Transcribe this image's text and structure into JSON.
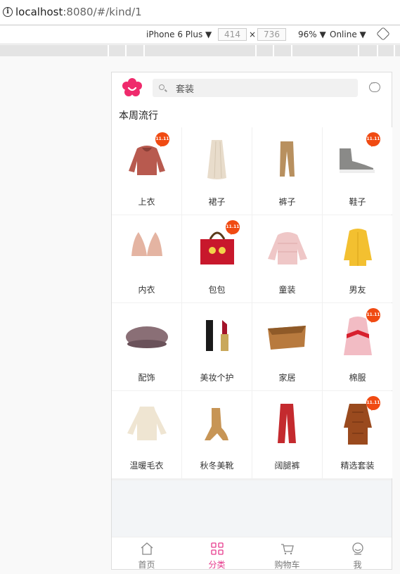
{
  "browser": {
    "url_host": "localhost",
    "url_rest": ":8080/#/kind/1"
  },
  "devtools": {
    "device": "iPhone 6 Plus ▼",
    "width": "414",
    "times": "×",
    "height": "736",
    "zoom": "96% ▼",
    "network": "Online ▼"
  },
  "header": {
    "search_placeholder": "套装"
  },
  "section_title": "本周流行",
  "badge_text": "11.11",
  "categories": [
    {
      "label": "上衣",
      "badge": true
    },
    {
      "label": "裙子",
      "badge": false
    },
    {
      "label": "裤子",
      "badge": false
    },
    {
      "label": "鞋子",
      "badge": true
    },
    {
      "label": "内衣",
      "badge": false
    },
    {
      "label": "包包",
      "badge": true
    },
    {
      "label": "童装",
      "badge": false
    },
    {
      "label": "男友",
      "badge": false
    },
    {
      "label": "配饰",
      "badge": false
    },
    {
      "label": "美妆个护",
      "badge": false
    },
    {
      "label": "家居",
      "badge": false
    },
    {
      "label": "棉服",
      "badge": true
    },
    {
      "label": "温暖毛衣",
      "badge": false
    },
    {
      "label": "秋冬美靴",
      "badge": false
    },
    {
      "label": "阔腿裤",
      "badge": false
    },
    {
      "label": "精选套装",
      "badge": true
    }
  ],
  "tabs": [
    {
      "label": "首页",
      "icon": "home-icon",
      "active": false
    },
    {
      "label": "分类",
      "icon": "category-icon",
      "active": true
    },
    {
      "label": "购物车",
      "icon": "cart-icon",
      "active": false
    },
    {
      "label": "我",
      "icon": "profile-icon",
      "active": false
    }
  ],
  "colors": {
    "accent": "#e6398c",
    "badge": "#f04a12"
  }
}
